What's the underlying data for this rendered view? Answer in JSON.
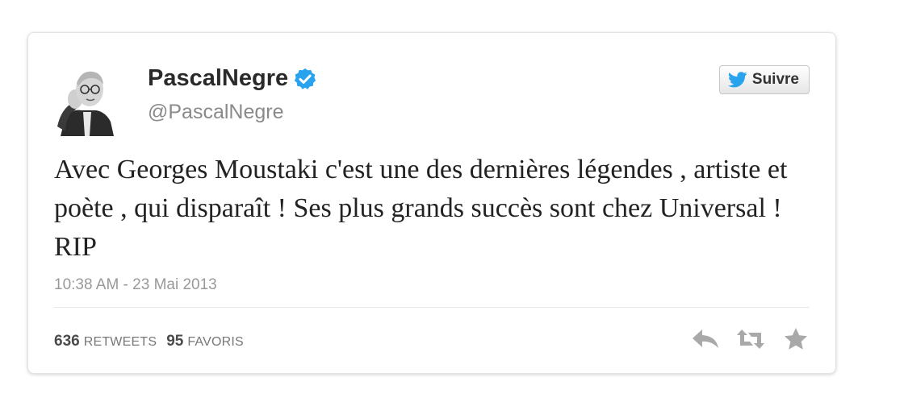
{
  "tweet": {
    "display_name": "PascalNegre",
    "verified_icon": "verified-badge-icon",
    "screen_name": "@PascalNegre",
    "follow_label": "Suivre",
    "text": "Avec Georges Moustaki c'est une des dernières légendes , artiste et poète , qui disparaît ! Ses plus grands succès sont chez Universal ! RIP",
    "timestamp": "10:38 AM - 23 Mai 2013",
    "retweets_count": "636",
    "retweets_label": "RETWEETS",
    "favorites_count": "95",
    "favorites_label": "FAVORIS"
  },
  "icons": {
    "follow": "twitter-bird-icon",
    "reply": "reply-icon",
    "retweet": "retweet-icon",
    "favorite": "star-icon"
  },
  "colors": {
    "verified": "#2aa3ef",
    "bird": "#2aa3ef",
    "action_icons": "#a9a9a9"
  }
}
